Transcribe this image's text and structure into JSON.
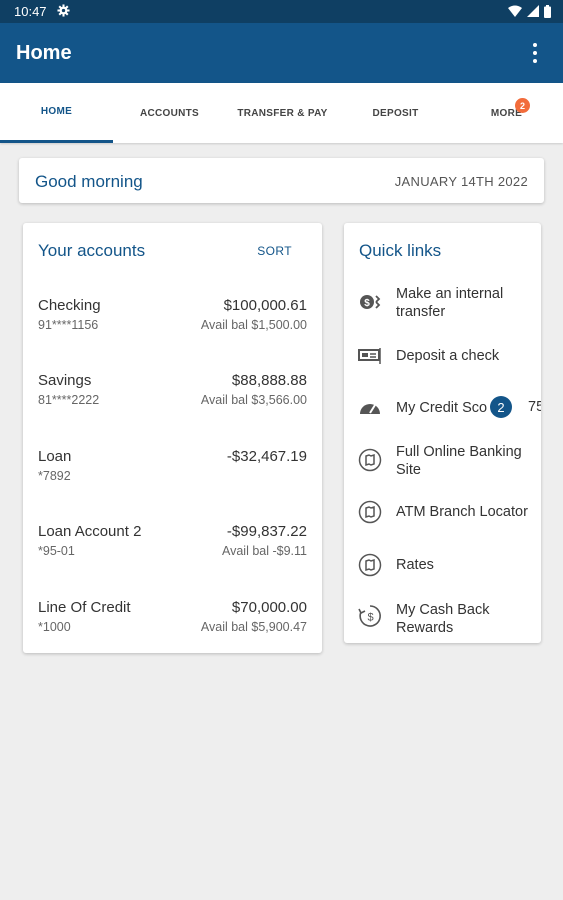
{
  "status_bar": {
    "time": "10:47"
  },
  "app_bar": {
    "title": "Home"
  },
  "tabs": [
    {
      "label": "HOME",
      "active": true
    },
    {
      "label": "ACCOUNTS"
    },
    {
      "label": "TRANSFER & PAY"
    },
    {
      "label": "DEPOSIT"
    },
    {
      "label": "MORE",
      "badge": "2"
    }
  ],
  "greeting": {
    "text": "Good morning",
    "date": "JANUARY 14TH 2022"
  },
  "accounts": {
    "title": "Your accounts",
    "sort_label": "SORT",
    "items": [
      {
        "name": "Checking",
        "number": "91****1156",
        "balance": "$100,000.61",
        "avail": "Avail bal $1,500.00"
      },
      {
        "name": "Savings",
        "number": "81****2222",
        "balance": "$88,888.88",
        "avail": "Avail bal $3,566.00"
      },
      {
        "name": "Loan",
        "number": "*7892",
        "balance": "-$32,467.19",
        "avail": ""
      },
      {
        "name": "Loan Account 2",
        "number": "*95-01",
        "balance": "-$99,837.22",
        "avail": "Avail bal -$9.11"
      },
      {
        "name": "Line Of Credit",
        "number": "*1000",
        "balance": "$70,000.00",
        "avail": "Avail bal $5,900.47"
      }
    ]
  },
  "quick_links": {
    "title": "Quick links",
    "items": [
      {
        "label_line1": "Make an internal",
        "label_line2": "transfer",
        "icon": "transfer-icon"
      },
      {
        "label_line1": "Deposit a check",
        "label_line2": "",
        "icon": "check-deposit-icon"
      },
      {
        "label_line1": "My Credit Sco",
        "label_line2": "",
        "icon": "gauge-icon",
        "badge": "2",
        "score": "75"
      },
      {
        "label_line1": "Full Online Banking",
        "label_line2": "Site",
        "icon": "map-icon"
      },
      {
        "label_line1": "ATM Branch Locator",
        "label_line2": "",
        "icon": "map-icon"
      },
      {
        "label_line1": "Rates",
        "label_line2": "",
        "icon": "map-icon"
      },
      {
        "label_line1": "My Cash Back",
        "label_line2": "Rewards",
        "icon": "cash-back-icon"
      }
    ]
  },
  "colors": {
    "primary": "#135589",
    "status_bar": "#0f3f63",
    "badge": "#f26c3b",
    "background": "#eeeeee"
  }
}
